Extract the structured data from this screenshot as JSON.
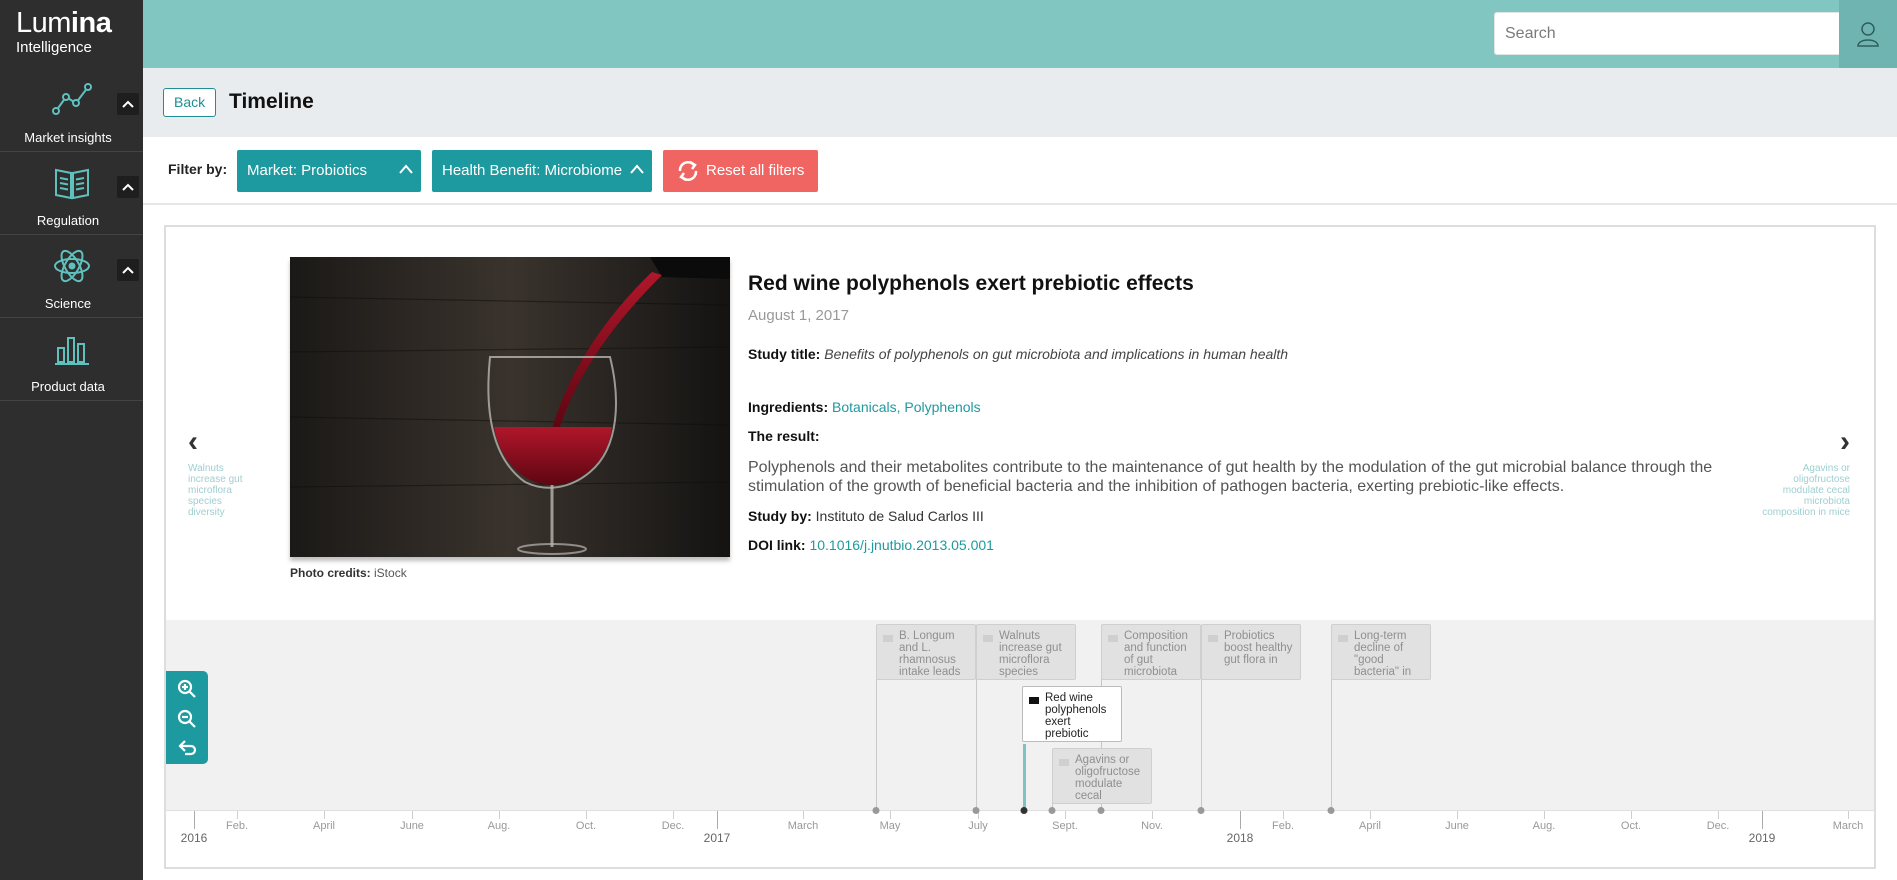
{
  "brand": {
    "name_light": "Lum",
    "name_bold": "ina",
    "subtitle": "Intelligence"
  },
  "sidebar": {
    "items": [
      {
        "label": "Market insights",
        "icon": "chart-line-icon",
        "has_toggle": true
      },
      {
        "label": "Regulation",
        "icon": "book-icon",
        "has_toggle": true
      },
      {
        "label": "Science",
        "icon": "atom-icon",
        "has_toggle": true
      },
      {
        "label": "Product data",
        "icon": "bar-chart-icon",
        "has_toggle": false
      }
    ]
  },
  "header": {
    "search_placeholder": "Search"
  },
  "titlebar": {
    "back_label": "Back",
    "title": "Timeline"
  },
  "filters": {
    "label": "Filter by:",
    "market": "Market: Probiotics",
    "health_benefit": "Health Benefit: Microbiome",
    "reset": "Reset all filters"
  },
  "article": {
    "title": "Red wine polyphenols exert prebiotic effects",
    "date": "August 1, 2017",
    "study_title_label": "Study title:",
    "study_title": "Benefits of polyphenols on gut microbiota and implications in human health",
    "ingredients_label": "Ingredients:",
    "ingredients": "Botanicals, Polyphenols",
    "result_label": "The result:",
    "result_text": "Polyphenols and their metabolites contribute to the maintenance of gut health by the modulation of the gut microbial balance through the stimulation of the growth of beneficial bacteria and the inhibition of pathogen bacteria, exerting prebiotic-like effects.",
    "study_by_label": "Study by:",
    "study_by": "Instituto de Salud Carlos III",
    "doi_label": "DOI link:",
    "doi": "10.1016/j.jnutbio.2013.05.001",
    "photo_credit_label": "Photo credits:",
    "photo_credit": "iStock"
  },
  "navigation": {
    "prev_arrow": "‹",
    "prev_hint": "Walnuts increase gut microflora species diversity",
    "next_arrow": "›",
    "next_hint": "Agavins or oligofructose modulate cecal microbiota composition in mice"
  },
  "timeline": {
    "events": [
      {
        "label": "B. Longum and L. rhamnosus intake leads",
        "active": false
      },
      {
        "label": "Walnuts increase gut microflora species",
        "active": false
      },
      {
        "label": "Composition and function of gut microbiota",
        "active": false
      },
      {
        "label": "Probiotics boost healthy gut flora in",
        "active": false
      },
      {
        "label": "Long-term decline of \"good bacteria\" in",
        "active": false
      },
      {
        "label": "Red wine polyphenols exert prebiotic",
        "active": true
      },
      {
        "label": "Agavins or oligofructose modulate cecal",
        "active": false
      }
    ],
    "minor_labels": [
      "Feb.",
      "April",
      "June",
      "Aug.",
      "Oct.",
      "Dec.",
      "March",
      "May",
      "July",
      "Sept.",
      "Nov.",
      "Feb.",
      "April",
      "June",
      "Aug.",
      "Oct.",
      "Dec.",
      "March"
    ],
    "major_labels": [
      "2016",
      "2017",
      "2018",
      "2019"
    ]
  }
}
